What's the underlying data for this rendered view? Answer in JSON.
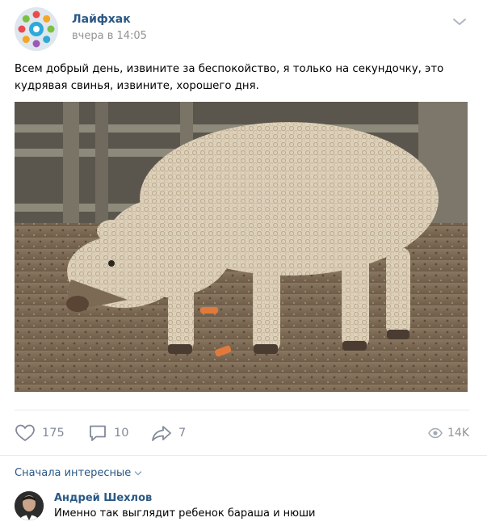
{
  "post": {
    "group_name": "Лайфхак",
    "time": "вчера в 14:05",
    "text": "Всем добрый день, извините за беспокойство, я только на секундочку, это кудрявая свинья, извините, хорошего дня.",
    "image_icon": "curly-pig-photo"
  },
  "actions": {
    "likes": "175",
    "comments": "10",
    "shares": "7",
    "views": "14K"
  },
  "comments_section": {
    "sort_label": "Сначала интересные",
    "comments": [
      {
        "author": "Андрей Шехлов",
        "text": "Именно так выглядит ребенок бараша и нюши"
      }
    ]
  },
  "colors": {
    "link": "#2a5885",
    "muted": "#828a99",
    "divider": "#e7e8ec"
  }
}
